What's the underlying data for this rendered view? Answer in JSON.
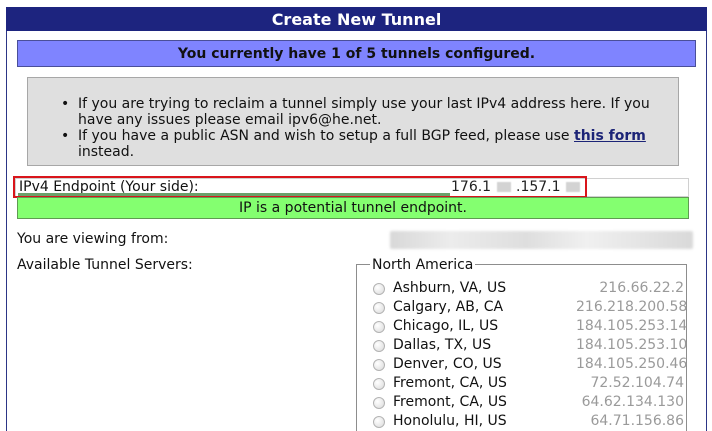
{
  "window": {
    "title": "Create New Tunnel"
  },
  "notice": {
    "text": "You currently have 1 of 5 tunnels configured."
  },
  "info": {
    "bullets": [
      {
        "text": "If you are trying to reclaim a tunnel simply use your last IPv4 address here. If you have any issues please email ipv6@he.net."
      },
      {
        "prefix": "If you have a public ASN and wish to setup a full BGP feed, please use",
        "link": "this form",
        "suffix": "instead."
      }
    ]
  },
  "endpoint": {
    "label": "IPv4 Endpoint (Your side):",
    "visible_segments": [
      "176.1",
      ".157.1"
    ]
  },
  "status": {
    "message": "IP is a potential tunnel endpoint."
  },
  "viewing": {
    "label": "You are viewing from:"
  },
  "servers": {
    "label": "Available Tunnel Servers:",
    "group": "North America",
    "items": [
      {
        "name": "Ashburn, VA, US",
        "ip": "216.66.22.2"
      },
      {
        "name": "Calgary, AB, CA",
        "ip": "216.218.200.58"
      },
      {
        "name": "Chicago, IL, US",
        "ip": "184.105.253.14"
      },
      {
        "name": "Dallas, TX, US",
        "ip": "184.105.253.10"
      },
      {
        "name": "Denver, CO, US",
        "ip": "184.105.250.46"
      },
      {
        "name": "Fremont, CA, US",
        "ip": "72.52.104.74"
      },
      {
        "name": "Fremont, CA, US",
        "ip": "64.62.134.130"
      },
      {
        "name": "Honolulu, HI, US",
        "ip": "64.71.156.86"
      }
    ]
  },
  "colors": {
    "title_bar": "#1d247f",
    "notice_bg": "#7f84ff",
    "status_bg": "#84ff70",
    "highlight": "#d9151b",
    "link": "#1c2477"
  },
  "icons": {
    "bullet": "bullet-dot-icon",
    "radio": "radio-button-icon"
  }
}
